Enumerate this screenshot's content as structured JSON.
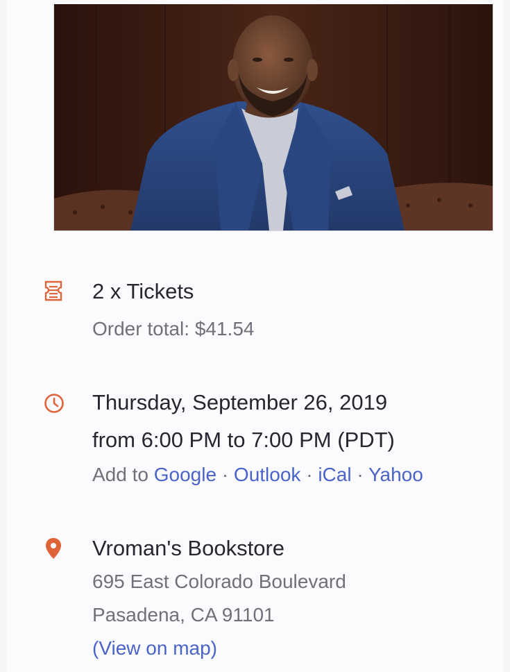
{
  "tickets": {
    "icon": "ticket-icon",
    "title": "2 x Tickets",
    "order_total": "Order total: $41.54"
  },
  "datetime": {
    "icon": "clock-icon",
    "date": "Thursday, September 26, 2019",
    "time": "from 6:00 PM to 7:00 PM (PDT)",
    "add_to_label": "Add to",
    "calendars": [
      "Google",
      "Outlook",
      "iCal",
      "Yahoo"
    ],
    "separator": "·"
  },
  "location": {
    "icon": "map-pin-icon",
    "name": "Vroman's Bookstore",
    "street": "695 East Colorado Boulevard",
    "city": "Pasadena, CA 91101",
    "map_link": "(View on map)"
  },
  "colors": {
    "accent": "#e0643a",
    "link": "#4a63c9",
    "text": "#262630",
    "muted": "#6f7079"
  }
}
